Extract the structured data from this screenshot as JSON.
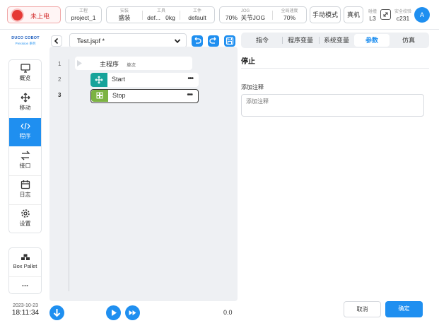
{
  "topbar": {
    "power_status": "未上电",
    "project_label": "工程",
    "project_value": "project_1",
    "install_label": "安装",
    "install_value": "盛装",
    "tool_label": "工具",
    "tool_value": "def...",
    "tool_weight": "0kg",
    "workpiece_label": "工件",
    "workpiece_value": "default",
    "jog_label": "JOG",
    "jog_speed": "70%",
    "jog_mode": "关节JOG",
    "global_speed_label": "全局速度",
    "global_speed_value": "70%",
    "manual_mode": "手动模式",
    "real_machine": "真机",
    "collision_label": "碰撞",
    "collision_value": "L3",
    "safety_label": "安全校验",
    "safety_value": "c231",
    "avatar_letter": "A"
  },
  "brand": {
    "name": "DUCO COBOT",
    "sub": "Precision 系列"
  },
  "sidebar": {
    "items": [
      {
        "label": "概览",
        "icon": "monitor-icon"
      },
      {
        "label": "移动",
        "icon": "move-icon"
      },
      {
        "label": "程序",
        "icon": "code-icon"
      },
      {
        "label": "接口",
        "icon": "swap-icon"
      },
      {
        "label": "日志",
        "icon": "calendar-icon"
      },
      {
        "label": "设置",
        "icon": "gear-icon"
      }
    ]
  },
  "plugin": {
    "label": "Box Pallet",
    "more": "..."
  },
  "clock": {
    "date": "2023-10-23",
    "time": "18:11:34"
  },
  "editor": {
    "file_name": "Test.jspf *",
    "main_program": "主程序",
    "main_program_tag": "单次",
    "line_numbers": [
      "1",
      "2",
      "3"
    ],
    "blocks": [
      {
        "label": "Start",
        "icon": "move-icon",
        "color": "#16a39a"
      },
      {
        "label": "Stop",
        "icon": "grid-icon",
        "color": "#7cb342"
      }
    ],
    "progress": "0.0"
  },
  "tabs": [
    "指令",
    "程序变量",
    "系统变量",
    "参数",
    "仿真"
  ],
  "tab_active_index": 3,
  "panel": {
    "title": "停止",
    "comment_label": "添加注释",
    "comment_placeholder": "添加注释",
    "cancel": "取消",
    "confirm": "确定"
  },
  "colors": {
    "accent": "#1f8ff0",
    "power_red": "#e53935"
  }
}
